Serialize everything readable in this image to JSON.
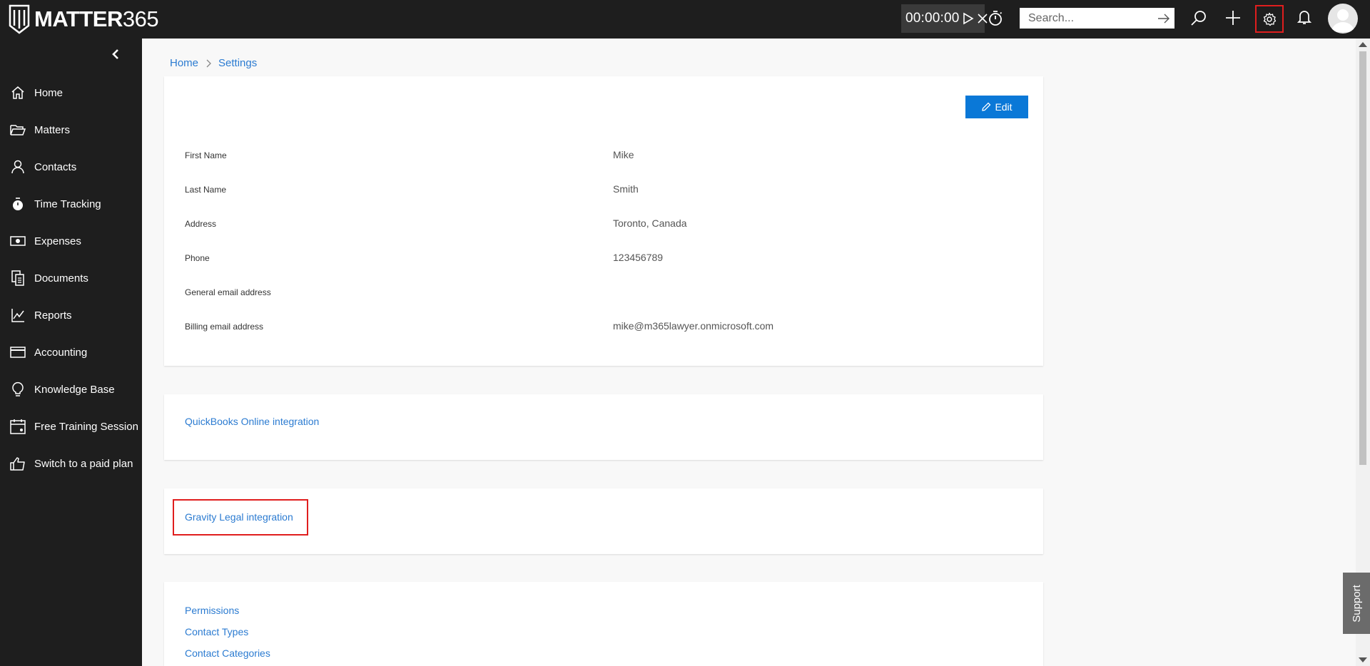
{
  "app": {
    "logo_bold": "MATTER",
    "logo_light": "365"
  },
  "topbar": {
    "timer_value": "00:00:00",
    "search_placeholder": "Search..."
  },
  "sidebar": {
    "items": [
      {
        "label": "Home",
        "icon": "home-icon"
      },
      {
        "label": "Matters",
        "icon": "folder-open-icon"
      },
      {
        "label": "Contacts",
        "icon": "person-icon"
      },
      {
        "label": "Time Tracking",
        "icon": "stopwatch-icon"
      },
      {
        "label": "Expenses",
        "icon": "money-icon"
      },
      {
        "label": "Documents",
        "icon": "documents-icon"
      },
      {
        "label": "Reports",
        "icon": "chart-icon"
      },
      {
        "label": "Accounting",
        "icon": "card-icon"
      },
      {
        "label": "Knowledge Base",
        "icon": "lightbulb-icon"
      },
      {
        "label": "Free Training Session",
        "icon": "calendar-icon"
      },
      {
        "label": "Switch to a paid plan",
        "icon": "thumbs-up-icon"
      }
    ]
  },
  "breadcrumb": {
    "home": "Home",
    "current": "Settings"
  },
  "profile": {
    "edit_label": "Edit",
    "fields": [
      {
        "label": "First Name",
        "value": "Mike"
      },
      {
        "label": "Last Name",
        "value": "Smith"
      },
      {
        "label": "Address",
        "value": "Toronto, Canada"
      },
      {
        "label": "Phone",
        "value": "123456789"
      },
      {
        "label": "General email address",
        "value": ""
      },
      {
        "label": "Billing email address",
        "value": "mike@m365lawyer.onmicrosoft.com"
      }
    ]
  },
  "integrations": {
    "quickbooks": "QuickBooks Online integration",
    "gravity": "Gravity Legal integration"
  },
  "settings_links": [
    "Permissions",
    "Contact Types",
    "Contact Categories"
  ],
  "support_label": "Support",
  "colors": {
    "topbar": "#1e1e1e",
    "accent": "#0a78d7",
    "link": "#2b7bd1",
    "highlight": "#e01e1e"
  }
}
